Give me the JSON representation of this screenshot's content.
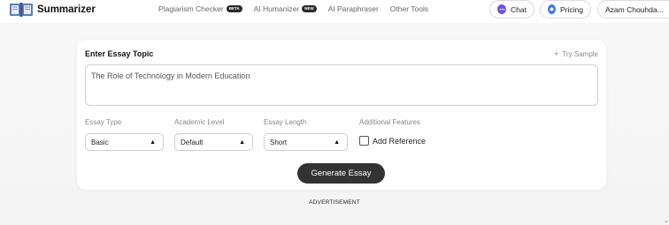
{
  "header": {
    "brand": "Summarizer",
    "nav": [
      {
        "label": "Plagiarism Checker",
        "badge": "BETA"
      },
      {
        "label": "AI Humanizer",
        "badge": "NEW"
      },
      {
        "label": "AI Paraphraser"
      },
      {
        "label": "Other Tools"
      }
    ],
    "chat_label": "Chat",
    "pricing_label": "Pricing",
    "user_name": "Azam Chouhda..."
  },
  "form": {
    "title": "Enter Essay Topic",
    "try_sample": "Try Sample",
    "topic_value": "The Role of Technology in Modern Education",
    "essay_type": {
      "label": "Essay Type",
      "value": "Basic"
    },
    "academic_level": {
      "label": "Academic Level",
      "value": "Default"
    },
    "essay_length": {
      "label": "Essay Length",
      "value": "Short"
    },
    "additional_features": {
      "label": "Additional Features",
      "checkbox_label": "Add Reference",
      "checked": false
    },
    "generate_label": "Generate Essay"
  },
  "advertisement": "ADVERTISEMENT",
  "colors": {
    "button_bg": "#333333",
    "chat_icon": "#6f4fe0",
    "pricing_icon": "#3d7be0"
  },
  "icons": {
    "logo": "book-logo-icon",
    "chat": "chat-bubble-icon",
    "pricing": "pricing-tag-icon",
    "caret": "caret-up-icon"
  }
}
